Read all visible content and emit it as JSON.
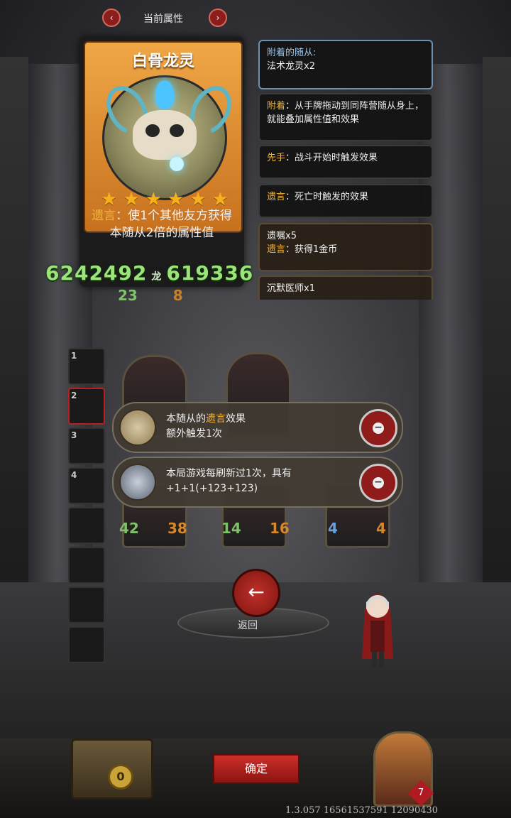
{
  "topnav": {
    "prev_icon": "chevron-left-icon",
    "title": "当前属性",
    "next_icon": "chevron-right-icon"
  },
  "card": {
    "name": "白骨龙灵",
    "stars": 6,
    "star_symbol": "★",
    "desc_keyword": "遗言",
    "desc_rest": "：使1个其他友方获得本随从2倍的属性值"
  },
  "stats": {
    "left": "6242492",
    "mid": "龙",
    "right": "619336"
  },
  "minion_stats": {
    "atk": "23",
    "hp": "8"
  },
  "info_panels": [
    {
      "line1": "附着的随从:",
      "line2": "法术龙灵x2"
    },
    {
      "keyword": "附着",
      "text": "：从手牌拖动到同阵营随从身上，就能叠加属性值和效果"
    },
    {
      "keyword": "先手",
      "text": "：战斗开始时触发效果"
    },
    {
      "keyword": "遗言",
      "text": "：死亡时触发的效果"
    },
    {
      "line1": "遗嘱x5",
      "keyword": "遗言",
      "text": "：获得1金币"
    },
    {
      "line1": "沉默医师x1"
    }
  ],
  "slots": [
    "1",
    "2",
    "3",
    "4",
    "",
    "",
    "",
    ""
  ],
  "boards": [
    {
      "atk": "42",
      "hp": "38"
    },
    {
      "atk": "14",
      "hp": "16"
    },
    {
      "atk": "4",
      "hp": "4"
    }
  ],
  "effects": [
    {
      "pre": "本随从的",
      "keyword": "遗言",
      "post": "效果",
      "line2": "额外触发1次"
    },
    {
      "line1": "本局游戏每刷新过1次，具有",
      "line2": "+1+1(+123+123)"
    }
  ],
  "back": {
    "arrow": "←",
    "label": "返回"
  },
  "confirm_label": "确定",
  "gold": "0",
  "hero_hp": "7",
  "version": "1.3.057 16561537591 12090430",
  "colors": {
    "keyword": "#f2b63a",
    "stat_green": "#9be37a",
    "confirm_red": "#cc2f2a"
  }
}
